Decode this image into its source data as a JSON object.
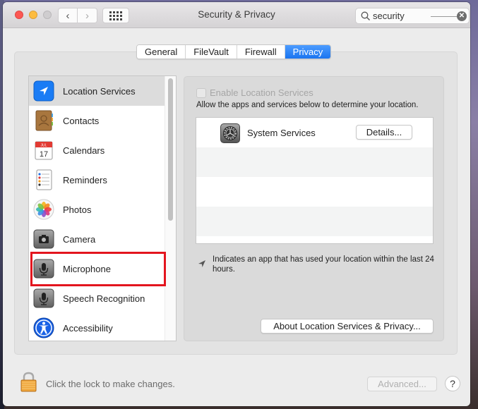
{
  "window": {
    "title": "Security & Privacy",
    "nav": {
      "back_glyph": "‹",
      "forward_glyph": "›"
    },
    "search": {
      "value": "security",
      "placeholder": "Search",
      "clear_glyph": "✕"
    }
  },
  "tabs": [
    {
      "label": "General",
      "active": false
    },
    {
      "label": "FileVault",
      "active": false
    },
    {
      "label": "Firewall",
      "active": false
    },
    {
      "label": "Privacy",
      "active": true
    }
  ],
  "sidebar": {
    "items": [
      {
        "label": "Location Services",
        "icon": "location-arrow-icon",
        "selected": true
      },
      {
        "label": "Contacts",
        "icon": "contacts-book-icon",
        "selected": false
      },
      {
        "label": "Calendars",
        "icon": "calendar-icon",
        "selected": false,
        "icon_text": {
          "month": "JUL",
          "day": "17"
        }
      },
      {
        "label": "Reminders",
        "icon": "reminders-list-icon",
        "selected": false
      },
      {
        "label": "Photos",
        "icon": "photos-flower-icon",
        "selected": false
      },
      {
        "label": "Camera",
        "icon": "camera-icon",
        "selected": false
      },
      {
        "label": "Microphone",
        "icon": "microphone-icon",
        "selected": false,
        "highlighted": true
      },
      {
        "label": "Speech Recognition",
        "icon": "microphone-icon",
        "selected": false
      },
      {
        "label": "Accessibility",
        "icon": "accessibility-figure-icon",
        "selected": false
      }
    ]
  },
  "location_pane": {
    "enable_checkbox": {
      "label": "Enable Location Services",
      "checked": false,
      "disabled": true
    },
    "description": "Allow the apps and services below to determine your location.",
    "apps": [
      {
        "name": "System Services",
        "icon": "system-preferences-gear-icon",
        "button": "Details..."
      }
    ],
    "indicator_text": "Indicates an app that has used your location within the last 24 hours.",
    "about_button": "About Location Services & Privacy..."
  },
  "footer": {
    "lock_text": "Click the lock to make changes.",
    "advanced_button": "Advanced...",
    "help_glyph": "?"
  },
  "colors": {
    "accent": "#1a74f0",
    "highlight_box": "#e3151e",
    "selected_row": "#dcdcdc"
  }
}
